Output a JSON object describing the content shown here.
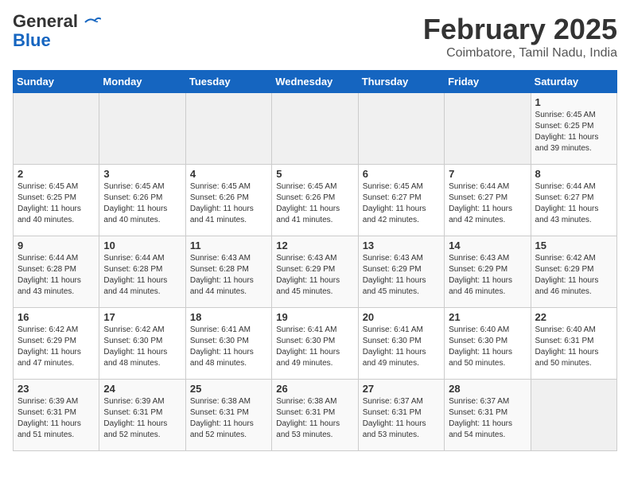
{
  "header": {
    "logo_general": "General",
    "logo_blue": "Blue",
    "month_year": "February 2025",
    "location": "Coimbatore, Tamil Nadu, India"
  },
  "days_of_week": [
    "Sunday",
    "Monday",
    "Tuesday",
    "Wednesday",
    "Thursday",
    "Friday",
    "Saturday"
  ],
  "weeks": [
    [
      {
        "day": "",
        "empty": true
      },
      {
        "day": "",
        "empty": true
      },
      {
        "day": "",
        "empty": true
      },
      {
        "day": "",
        "empty": true
      },
      {
        "day": "",
        "empty": true
      },
      {
        "day": "",
        "empty": true
      },
      {
        "day": "1",
        "sunrise": "6:45 AM",
        "sunset": "6:25 PM",
        "daylight": "11 hours and 39 minutes."
      }
    ],
    [
      {
        "day": "2",
        "sunrise": "6:45 AM",
        "sunset": "6:25 PM",
        "daylight": "11 hours and 40 minutes."
      },
      {
        "day": "3",
        "sunrise": "6:45 AM",
        "sunset": "6:26 PM",
        "daylight": "11 hours and 40 minutes."
      },
      {
        "day": "4",
        "sunrise": "6:45 AM",
        "sunset": "6:26 PM",
        "daylight": "11 hours and 41 minutes."
      },
      {
        "day": "5",
        "sunrise": "6:45 AM",
        "sunset": "6:26 PM",
        "daylight": "11 hours and 41 minutes."
      },
      {
        "day": "6",
        "sunrise": "6:45 AM",
        "sunset": "6:27 PM",
        "daylight": "11 hours and 42 minutes."
      },
      {
        "day": "7",
        "sunrise": "6:44 AM",
        "sunset": "6:27 PM",
        "daylight": "11 hours and 42 minutes."
      },
      {
        "day": "8",
        "sunrise": "6:44 AM",
        "sunset": "6:27 PM",
        "daylight": "11 hours and 43 minutes."
      }
    ],
    [
      {
        "day": "9",
        "sunrise": "6:44 AM",
        "sunset": "6:28 PM",
        "daylight": "11 hours and 43 minutes."
      },
      {
        "day": "10",
        "sunrise": "6:44 AM",
        "sunset": "6:28 PM",
        "daylight": "11 hours and 44 minutes."
      },
      {
        "day": "11",
        "sunrise": "6:43 AM",
        "sunset": "6:28 PM",
        "daylight": "11 hours and 44 minutes."
      },
      {
        "day": "12",
        "sunrise": "6:43 AM",
        "sunset": "6:29 PM",
        "daylight": "11 hours and 45 minutes."
      },
      {
        "day": "13",
        "sunrise": "6:43 AM",
        "sunset": "6:29 PM",
        "daylight": "11 hours and 45 minutes."
      },
      {
        "day": "14",
        "sunrise": "6:43 AM",
        "sunset": "6:29 PM",
        "daylight": "11 hours and 46 minutes."
      },
      {
        "day": "15",
        "sunrise": "6:42 AM",
        "sunset": "6:29 PM",
        "daylight": "11 hours and 46 minutes."
      }
    ],
    [
      {
        "day": "16",
        "sunrise": "6:42 AM",
        "sunset": "6:29 PM",
        "daylight": "11 hours and 47 minutes."
      },
      {
        "day": "17",
        "sunrise": "6:42 AM",
        "sunset": "6:30 PM",
        "daylight": "11 hours and 48 minutes."
      },
      {
        "day": "18",
        "sunrise": "6:41 AM",
        "sunset": "6:30 PM",
        "daylight": "11 hours and 48 minutes."
      },
      {
        "day": "19",
        "sunrise": "6:41 AM",
        "sunset": "6:30 PM",
        "daylight": "11 hours and 49 minutes."
      },
      {
        "day": "20",
        "sunrise": "6:41 AM",
        "sunset": "6:30 PM",
        "daylight": "11 hours and 49 minutes."
      },
      {
        "day": "21",
        "sunrise": "6:40 AM",
        "sunset": "6:30 PM",
        "daylight": "11 hours and 50 minutes."
      },
      {
        "day": "22",
        "sunrise": "6:40 AM",
        "sunset": "6:31 PM",
        "daylight": "11 hours and 50 minutes."
      }
    ],
    [
      {
        "day": "23",
        "sunrise": "6:39 AM",
        "sunset": "6:31 PM",
        "daylight": "11 hours and 51 minutes."
      },
      {
        "day": "24",
        "sunrise": "6:39 AM",
        "sunset": "6:31 PM",
        "daylight": "11 hours and 52 minutes."
      },
      {
        "day": "25",
        "sunrise": "6:38 AM",
        "sunset": "6:31 PM",
        "daylight": "11 hours and 52 minutes."
      },
      {
        "day": "26",
        "sunrise": "6:38 AM",
        "sunset": "6:31 PM",
        "daylight": "11 hours and 53 minutes."
      },
      {
        "day": "27",
        "sunrise": "6:37 AM",
        "sunset": "6:31 PM",
        "daylight": "11 hours and 53 minutes."
      },
      {
        "day": "28",
        "sunrise": "6:37 AM",
        "sunset": "6:31 PM",
        "daylight": "11 hours and 54 minutes."
      },
      {
        "day": "",
        "empty": true
      }
    ]
  ]
}
